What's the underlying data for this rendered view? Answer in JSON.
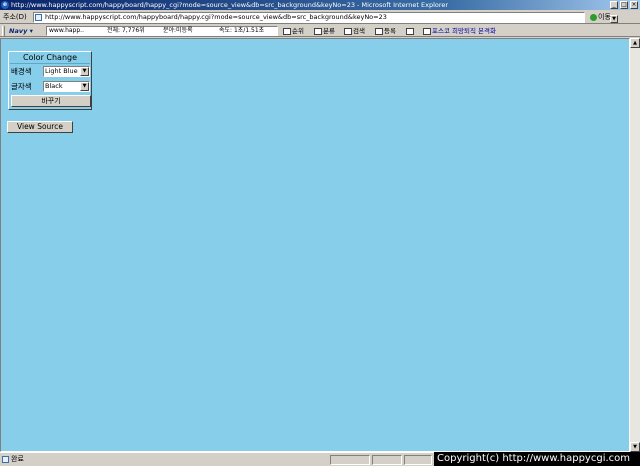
{
  "window": {
    "title": "http://www.happyscript.com/happyboard/happy_cgi?mode=source_view&db=src_background&keyNo=23 - Microsoft Internet Explorer",
    "controls": [
      "_",
      "□",
      "×"
    ]
  },
  "address_bar": {
    "label": "주소(D)",
    "url": "http://www.happyscript.com/happyboard/happy.cgi?mode=source_view&db=src_background&keyNo=23",
    "go_label": "이동"
  },
  "navy_toolbar": {
    "brand": "Navy ▾",
    "search_text": "www.happ..",
    "total": "전체: 7,776위",
    "category": "분야:미등록",
    "speed": "속도: 1초/1.51초",
    "buttons": [
      "순위",
      "분류",
      "검색",
      "등록"
    ],
    "promo": "포스코 희망퇴직 본격화"
  },
  "color_change": {
    "title": "Color Change",
    "bg_label": "배경색",
    "bg_value": "Light Blue",
    "text_label": "글자색",
    "text_value": "Black",
    "apply_label": "바꾸기"
  },
  "view_source_label": "View Source",
  "status_bar": {
    "text": "완료"
  },
  "copyright": "Copyright(c) http://www.happycgi.com",
  "colors": {
    "page_background": "#87ceeb",
    "title_bar": "#0a246a",
    "chrome": "#d4d0c8"
  }
}
